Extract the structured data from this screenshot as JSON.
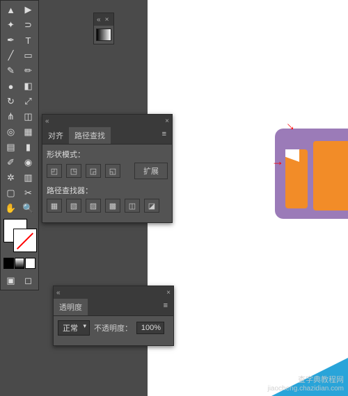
{
  "panels": {
    "pathfinder": {
      "tabs": [
        "对齐",
        "路径查找"
      ],
      "shape_mode_label": "形状模式：",
      "expand_label": "扩展",
      "pathfinder_label": "路径查找器："
    },
    "transparency": {
      "title": "透明度",
      "blend_mode": "正常",
      "opacity_label": "不透明度：",
      "opacity_value": "100%"
    }
  },
  "icons": {
    "collapse": "«",
    "close": "×",
    "menu": "≡"
  },
  "watermark": {
    "line1": "查字典教程网",
    "line2": "jiaocheng.chazidian.com"
  },
  "colors": {
    "purple": "#9b7bb8",
    "orange": "#f28c28",
    "accent": "#29a4d9"
  }
}
